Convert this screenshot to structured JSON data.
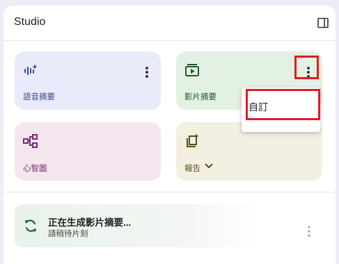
{
  "header": {
    "title": "Studio"
  },
  "cards": [
    {
      "label": "語音摘要",
      "color": "#3b4a8c"
    },
    {
      "label": "影片摘要",
      "color": "#1d5a2a"
    },
    {
      "label": "心智圖",
      "color": "#7a2a6a"
    },
    {
      "label": "報告",
      "color": "#5a4a1a"
    }
  ],
  "menu": {
    "items": [
      "自訂"
    ]
  },
  "generating": {
    "title": "正在生成影片摘要...",
    "subtitle": "請稍待片刻"
  },
  "icons": {
    "collapse": "side-panel-icon",
    "audio": "audio-sparkle-icon",
    "video": "video-play-icon",
    "mindmap": "mindmap-icon",
    "report": "report-sparkle-icon",
    "more": "more-vert-icon",
    "sync": "sync-icon",
    "chevron": "chevron-down-icon"
  },
  "colors": {
    "highlight": "#e01b24",
    "sync": "#1e6b2e"
  }
}
